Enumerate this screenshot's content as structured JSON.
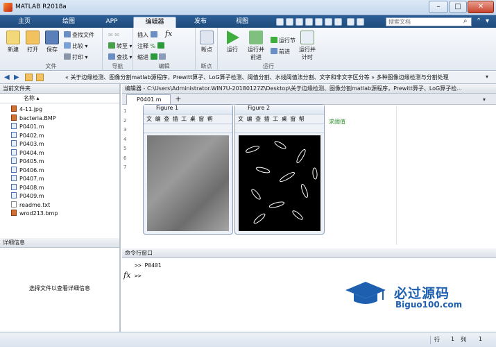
{
  "window": {
    "title": "MATLAB R2018a",
    "search_placeholder": "搜索文档"
  },
  "ribbon_tabs": [
    "主页",
    "绘图",
    "APP",
    "编辑器",
    "发布",
    "视图"
  ],
  "ribbon": {
    "file": {
      "new": "新建",
      "open": "打开",
      "save": "保存",
      "find_files": "查找文件",
      "compare": "比较",
      "print": "打印",
      "label": "文件"
    },
    "navigate": {
      "goto": "转至",
      "find": "查找",
      "label": "导航"
    },
    "edit": {
      "insert": "插入",
      "comment": "注释",
      "indent": "缩进",
      "fx": "fx",
      "label": "编辑"
    },
    "breakpoints": {
      "btn": "断点",
      "label": "断点"
    },
    "run": {
      "run": "运行",
      "run_advance": "运行并\n前进",
      "run_section": "运行节",
      "advance": "前进",
      "run_time": "运行并\n计时",
      "label": "运行"
    }
  },
  "address": {
    "path": "«  关于边缘检测、图像分割matlab源程序，Prewitt算子、LoG算子检测、阈值分割、水线阈值法分割、文字和非文字区分等  »  多种图像边缘检测与分割处理"
  },
  "current_folder": {
    "title": "当前文件夹",
    "col": "名称 ▴",
    "files": [
      "4-11.jpg",
      "bacteria.BMP",
      "P0401.m",
      "P0402.m",
      "P0403.m",
      "P0404.m",
      "P0405.m",
      "P0406.m",
      "P0407.m",
      "P0408.m",
      "P0409.m",
      "readme.txt",
      "wrod213.bmp"
    ]
  },
  "details": {
    "title": "详细信息",
    "hint": "选择文件以查看详细信息"
  },
  "editor": {
    "title": "编辑器 - C:\\Users\\Administrator.WIN7U-20180127Z\\Desktop\\关于边缘检测、图像分割matlab源程序，Prewitt算子、LoG算子检...",
    "tab": "P0401.m",
    "add": "+",
    "lines": [
      "1",
      "2",
      "3",
      "4",
      "5",
      "6",
      "7"
    ],
    "comment": "求阈值"
  },
  "figures": [
    {
      "title": "Figure 1",
      "menu": "文 编 查 插 工 桌 窗 帮"
    },
    {
      "title": "Figure 2",
      "menu": "文 编 查 插 工 桌 窗 帮"
    }
  ],
  "command_window": {
    "title": "命令行窗口",
    "history": ">> P0401",
    "prompt": ">>",
    "fx": "fx"
  },
  "status": {
    "row_label": "行",
    "row": "1",
    "col_label": "列",
    "col": "1"
  },
  "watermark": {
    "title": "必过源码",
    "url": "Biguo100.com"
  }
}
